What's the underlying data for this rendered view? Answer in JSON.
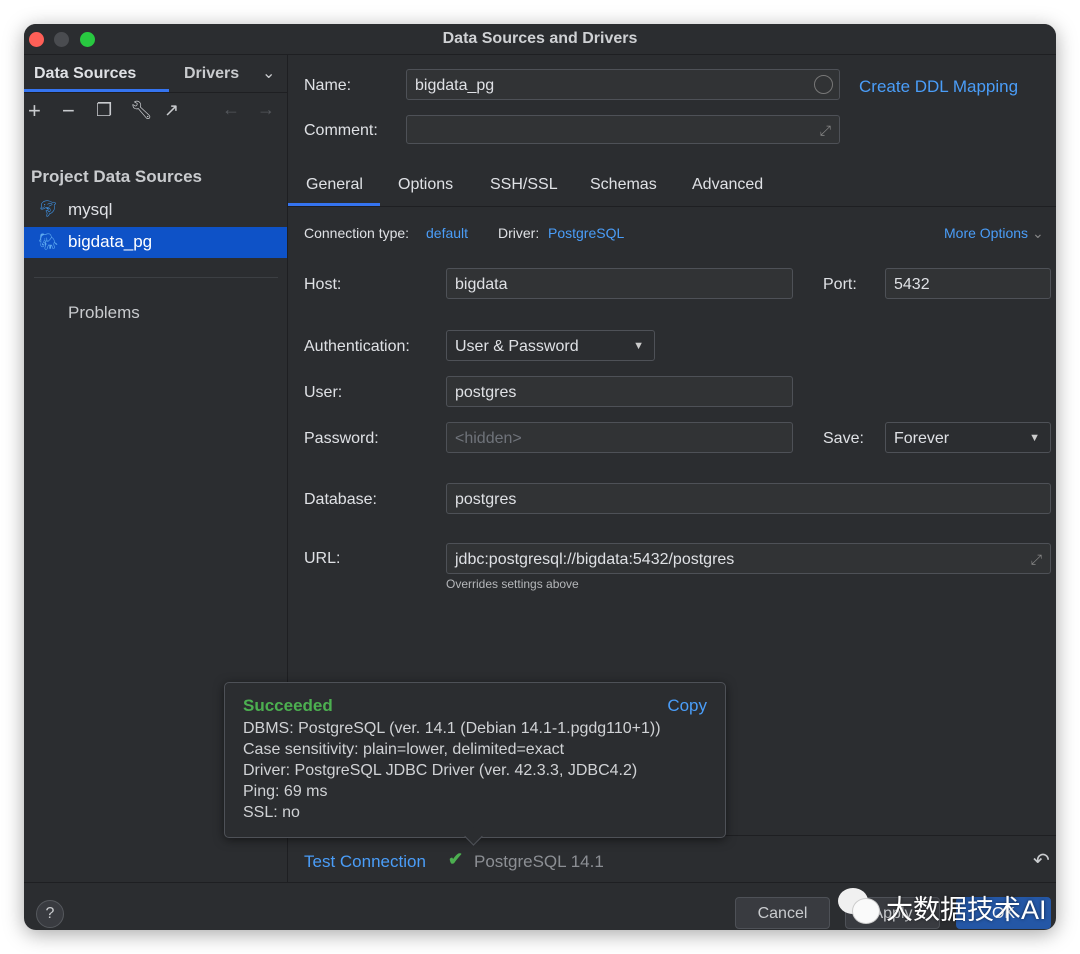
{
  "window": {
    "title": "Data Sources and Drivers"
  },
  "sidebar": {
    "tabs": [
      {
        "label": "Data Sources"
      },
      {
        "label": "Drivers"
      }
    ],
    "toolbar_icons": [
      "add-icon",
      "remove-icon",
      "duplicate-icon",
      "wrench-icon",
      "export-icon",
      "back-icon",
      "forward-icon"
    ],
    "section_title": "Project Data Sources",
    "items": [
      {
        "label": "mysql",
        "icon": "mysql-dolphin-icon"
      },
      {
        "label": "bigdata_pg",
        "icon": "postgresql-elephant-icon",
        "selected": true
      }
    ],
    "problems": "Problems"
  },
  "form": {
    "name_label": "Name:",
    "name_value": "bigdata_pg",
    "comment_label": "Comment:",
    "comment_value": "",
    "ddl_link": "Create DDL Mapping",
    "tabs": [
      {
        "label": "General",
        "active": true
      },
      {
        "label": "Options"
      },
      {
        "label": "SSH/SSL"
      },
      {
        "label": "Schemas"
      },
      {
        "label": "Advanced"
      }
    ],
    "connection_type_label": "Connection type:",
    "connection_type": "default",
    "driver_label": "Driver:",
    "driver": "PostgreSQL",
    "more_options": "More Options",
    "host_label": "Host:",
    "host": "bigdata",
    "port_label": "Port:",
    "port": "5432",
    "auth_label": "Authentication:",
    "auth": "User & Password",
    "user_label": "User:",
    "user": "postgres",
    "password_label": "Password:",
    "password_placeholder": "<hidden>",
    "save_label": "Save:",
    "save": "Forever",
    "database_label": "Database:",
    "database": "postgres",
    "url_label": "URL:",
    "url": "jdbc:postgresql://bigdata:5432/postgres",
    "url_hint": "Overrides settings above"
  },
  "popup": {
    "status": "Succeeded",
    "copy": "Copy",
    "lines": [
      "DBMS: PostgreSQL (ver. 14.1 (Debian 14.1-1.pgdg110+1))",
      "Case sensitivity: plain=lower, delimited=exact",
      "Driver: PostgreSQL JDBC Driver (ver. 42.3.3, JDBC4.2)",
      "Ping: 69 ms",
      "SSL: no"
    ]
  },
  "footer": {
    "test_connection": "Test Connection",
    "result": "PostgreSQL 14.1",
    "cancel": "Cancel",
    "apply": "Apply",
    "ok": "OK",
    "help": "?"
  },
  "watermark": "大数据技术AI",
  "colors": {
    "accent": "#4a9df8",
    "selection": "#0e52c7",
    "success": "#4caf50"
  }
}
